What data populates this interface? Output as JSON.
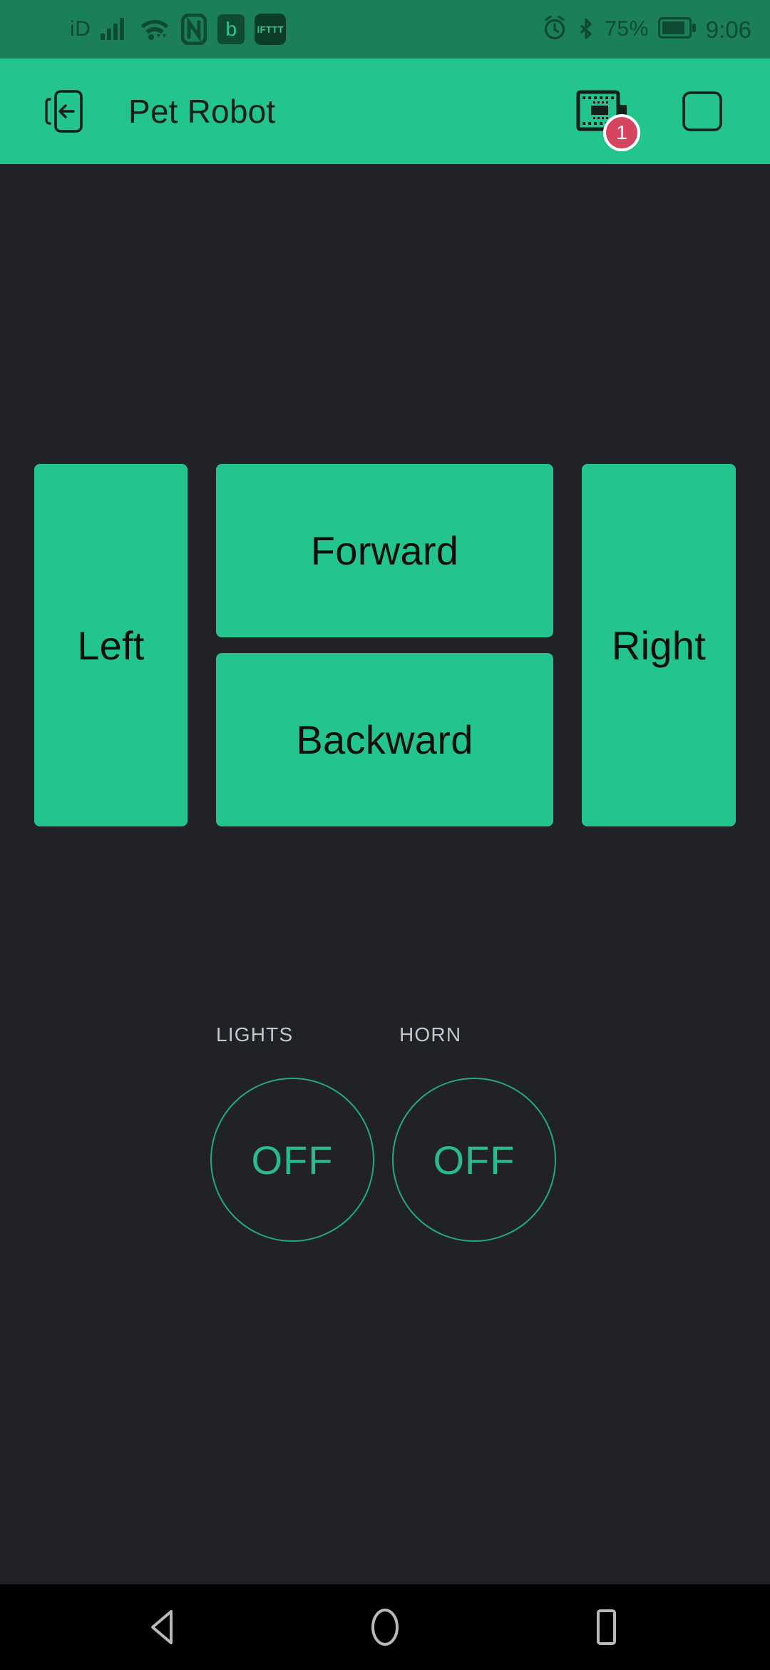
{
  "status_bar": {
    "carrier": "iD",
    "icons_left": [
      "signal-bars-icon",
      "wifi-icon",
      "nfc-icon",
      "blynk-icon",
      "ifttt-icon"
    ],
    "blynk_letter": "b",
    "ifttt_letter": "IFTTT",
    "icons_right": [
      "alarm-icon",
      "bluetooth-icon",
      "battery-icon"
    ],
    "battery_percent": "75%",
    "clock": "9:06",
    "background_color": "#1B8058",
    "foreground_color": "#0F4B34"
  },
  "app_bar": {
    "title": "Pet Robot",
    "back_icon": "exit-project-icon",
    "hardware_icon": "microcontroller-board-icon",
    "hardware_badge_count": "1",
    "play_icon": "stop-square-icon",
    "background_color": "#23C48E",
    "badge_color": "#D6455F"
  },
  "controls": {
    "accent_color": "#23C48E",
    "canvas_color": "#212227",
    "dpad": [
      {
        "name": "left",
        "label": "Left"
      },
      {
        "name": "forward",
        "label": "Forward"
      },
      {
        "name": "backward",
        "label": "Backward"
      },
      {
        "name": "right",
        "label": "Right"
      }
    ],
    "toggles": [
      {
        "name": "lights",
        "label": "LIGHTS",
        "value": "OFF"
      },
      {
        "name": "horn",
        "label": "HORN",
        "value": "OFF"
      }
    ],
    "toggle_outline_color": "#23A97C",
    "toggle_text_color": "#2BBB89",
    "label_color": "#C3C6CC"
  },
  "nav_bar": {
    "background_color": "#000000",
    "buttons": [
      "back-triangle-icon",
      "home-circle-icon",
      "recents-square-icon"
    ]
  }
}
